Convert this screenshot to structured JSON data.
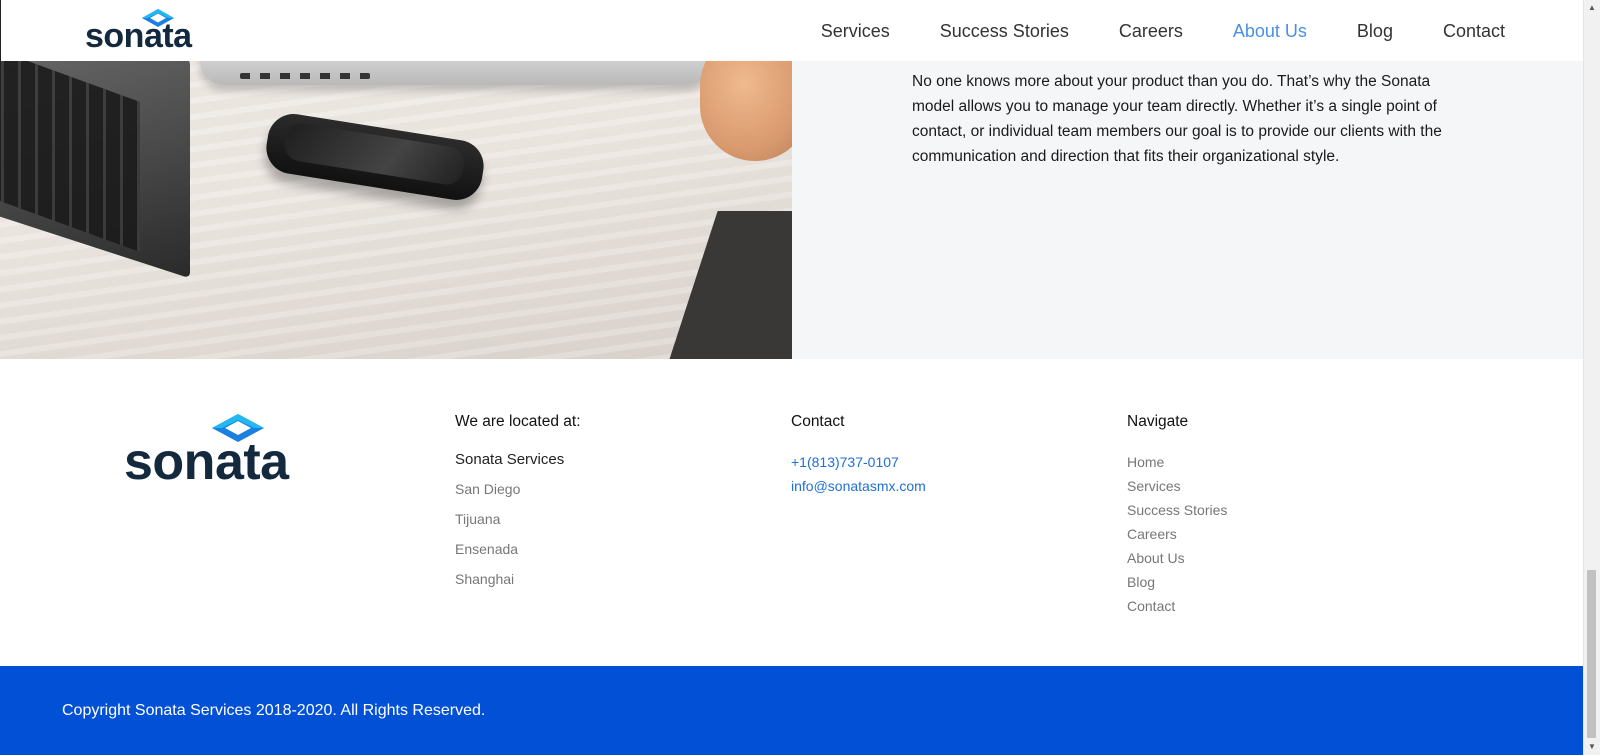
{
  "brand": {
    "logo_text": "sonata",
    "logo_color": "#13293d",
    "mark_colors": [
      "#22b8f0",
      "#1a7fe0"
    ]
  },
  "header": {
    "nav": [
      {
        "label": "Services"
      },
      {
        "label": "Success Stories"
      },
      {
        "label": "Careers"
      },
      {
        "label": "About Us",
        "active": true
      },
      {
        "label": "Blog"
      },
      {
        "label": "Contact"
      }
    ],
    "active_color": "#4a8fe7"
  },
  "hero": {
    "paragraph": "No one knows more about your product than you do. That’s why the Sonata model allows you to manage your team directly. Whether it’s a single point of contact, or individual team members our goal is to provide our clients with the communication and direction that fits their organizational style."
  },
  "footer": {
    "location": {
      "heading": "We are located at:",
      "company": "Sonata Services",
      "cities": [
        "San Diego",
        "Tijuana",
        "Ensenada",
        "Shanghai"
      ]
    },
    "contact": {
      "heading": "Contact",
      "phone": "+1(813)737-0107",
      "email": "info@sonatasmx.com"
    },
    "navigate": {
      "heading": "Navigate",
      "links": [
        "Home",
        "Services",
        "Success Stories",
        "Careers",
        "About Us",
        "Blog",
        "Contact"
      ]
    }
  },
  "copyright": {
    "text": "Copyright Sonata Services 2018-2020. All Rights Reserved.",
    "bar_color": "#0150d6"
  }
}
